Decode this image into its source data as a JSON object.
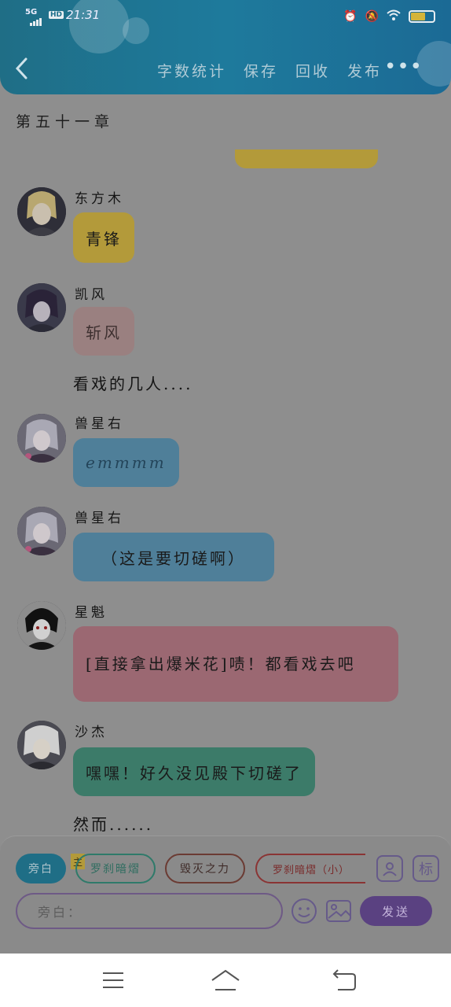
{
  "status_bar": {
    "network": "5G",
    "hd": "HD",
    "time": "21:31"
  },
  "header": {
    "menu": [
      "字数统计",
      "保存",
      "回收",
      "发布"
    ],
    "more": "•••"
  },
  "chapter_title": "第五十一章",
  "messages": [
    {
      "name": "东方木",
      "text": "青锋"
    },
    {
      "name": "凯风",
      "text": "斩风"
    },
    {
      "narration": "看戏的几人...."
    },
    {
      "name": "兽星右",
      "text": "emmmm"
    },
    {
      "name": "兽星右",
      "text": "（这是要切磋啊）"
    },
    {
      "name": "星魁",
      "text": "[直接拿出爆米花]啧！都看戏去吧"
    },
    {
      "name": "沙杰",
      "text": "嘿嘿！好久没见殿下切磋了"
    },
    {
      "narration": "然而......"
    }
  ],
  "bottom": {
    "chips": [
      "旁白",
      "罗刹暗熠",
      "毁灭之力",
      "罗刹暗熠（小）"
    ],
    "chip_badge": "主",
    "icon_label": "标",
    "input_placeholder": "旁白：",
    "send": "发送"
  },
  "colors": {
    "header": "#1e7a9c",
    "bubble_yellow": "#b39a3a",
    "bubble_pink": "#9a8080",
    "bubble_blue": "#4f7f99",
    "bubble_red": "#9b6872",
    "bubble_teal": "#3c7b69",
    "send": "#5a4181"
  }
}
